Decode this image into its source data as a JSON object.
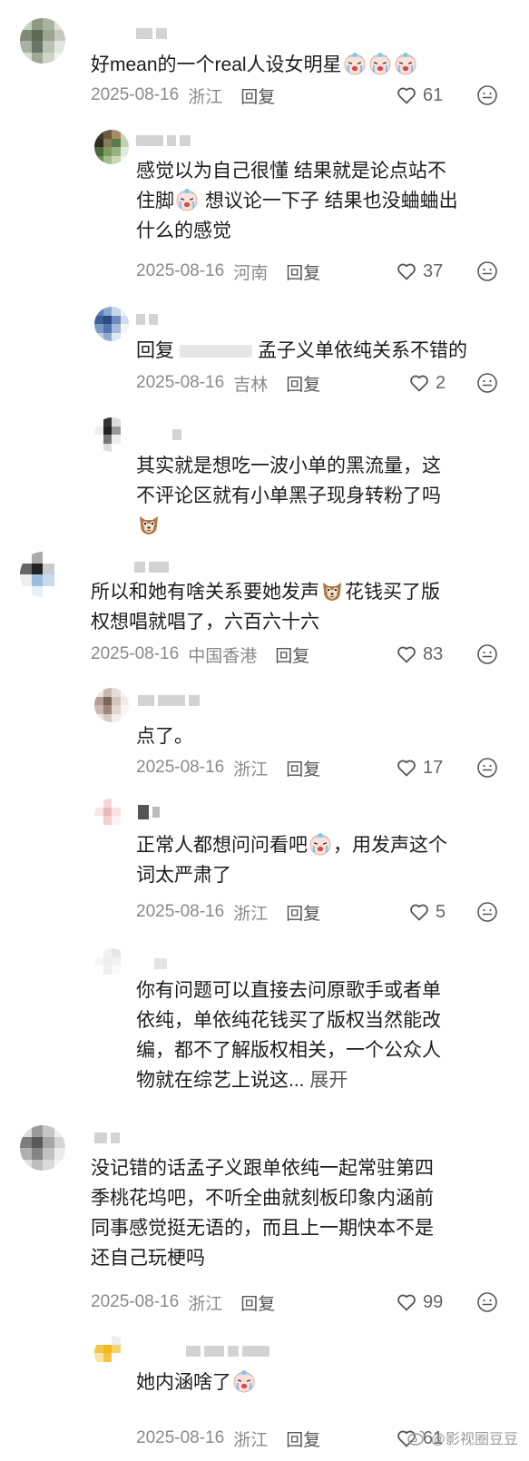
{
  "reply_label": "回复",
  "expand_label": "展开",
  "comments": [
    {
      "text": "好mean的一个real人设女明星",
      "date": "2025-08-16",
      "location": "浙江",
      "likes": "61"
    },
    {
      "text1": "感觉以为自己很懂 结果就是论点站不",
      "text2a": "住脚",
      "text2b": " 想议论一下子 结果也没蛐蛐出",
      "text3": "什么的感觉",
      "date": "2025-08-16",
      "location": "河南",
      "likes": "37"
    },
    {
      "prefix": "回复",
      "text": "孟子义单依纯关系不错的",
      "date": "2025-08-16",
      "location": "吉林",
      "likes": "2"
    },
    {
      "text1": "其实就是想吃一波小单的黑流量，这",
      "text2": "不评论区就有小单黑子现身转粉了吗"
    },
    {
      "text1a": "所以和她有啥关系要她发声",
      "text1b": "花钱买了版",
      "text2": "权想唱就唱了，六百六十六",
      "date": "2025-08-16",
      "location": "中国香港",
      "likes": "83"
    },
    {
      "text": "点了。",
      "date": "2025-08-16",
      "location": "浙江",
      "likes": "17"
    },
    {
      "text1a": "正常人都想问问看吧",
      "text1b": "，用发声这个",
      "text2": "词太严肃了",
      "date": "2025-08-16",
      "location": "浙江",
      "likes": "5"
    },
    {
      "text1": "你有问题可以直接去问原歌手或者单",
      "text2": "依纯，单依纯花钱买了版权当然能改",
      "text3": "编，都不了解版权相关，一个公众人",
      "text4": "物就在综艺上说这... "
    },
    {
      "text1": "没记错的话孟子义跟单依纯一起常驻第四",
      "text2": "季桃花坞吧，不听全曲就刻板印象内涵前",
      "text3": "同事感觉挺无语的，而且上一期快本不是",
      "text4": "还自己玩梗吗",
      "date": "2025-08-16",
      "location": "浙江",
      "likes": "99"
    },
    {
      "text": "她内涵啥了",
      "date": "2025-08-16",
      "location": "浙江",
      "likes": "61"
    }
  ],
  "watermark": "@影视圈豆豆",
  "colors": {
    "text": "#1c1c1c",
    "meta": "#8a8a8a",
    "icon": "#666666"
  }
}
